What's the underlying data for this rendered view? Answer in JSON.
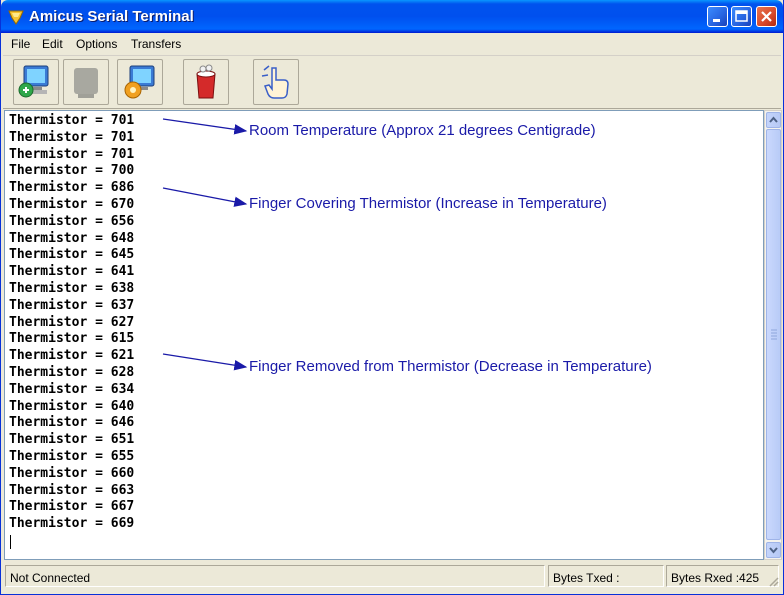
{
  "window": {
    "title": "Amicus Serial Terminal",
    "accent_color": "#0053ee"
  },
  "title_buttons": [
    "minimize-icon",
    "maximize-icon",
    "close-icon"
  ],
  "menu": [
    "File",
    "Edit",
    "Options",
    "Transfers"
  ],
  "toolbar": {
    "buttons": [
      {
        "icon": "connect-computer-icon",
        "enabled": true
      },
      {
        "icon": "disconnect-icon",
        "enabled": false
      },
      {
        "icon": "settings-gear-icon",
        "enabled": true
      },
      {
        "icon": "clear-screen-icon",
        "enabled": true
      },
      {
        "icon": "pointer-hand-icon",
        "enabled": true
      }
    ]
  },
  "terminal": {
    "lines": [
      "Thermistor = 701",
      "Thermistor = 701",
      "Thermistor = 701",
      "Thermistor = 700",
      "Thermistor = 686",
      "Thermistor = 670",
      "Thermistor = 656",
      "Thermistor = 648",
      "Thermistor = 645",
      "Thermistor = 641",
      "Thermistor = 638",
      "Thermistor = 637",
      "Thermistor = 627",
      "Thermistor = 615",
      "Thermistor = 621",
      "Thermistor = 628",
      "Thermistor = 634",
      "Thermistor = 640",
      "Thermistor = 646",
      "Thermistor = 651",
      "Thermistor = 655",
      "Thermistor = 660",
      "Thermistor = 663",
      "Thermistor = 667",
      "Thermistor = 669"
    ]
  },
  "annotations": [
    {
      "text": "Room Temperature (Approx 21 degrees Centigrade)",
      "points_to_line": 0
    },
    {
      "text": "Finger Covering Thermistor (Increase in Temperature)",
      "points_to_line": 4
    },
    {
      "text": "Finger Removed from Thermistor (Decrease in Temperature)",
      "points_to_line": 14
    }
  ],
  "annotation_color": "#1a1aa8",
  "status": {
    "connection": "Not Connected",
    "bytes_txed": "Bytes Txed :",
    "bytes_rxed": "Bytes Rxed :425"
  }
}
